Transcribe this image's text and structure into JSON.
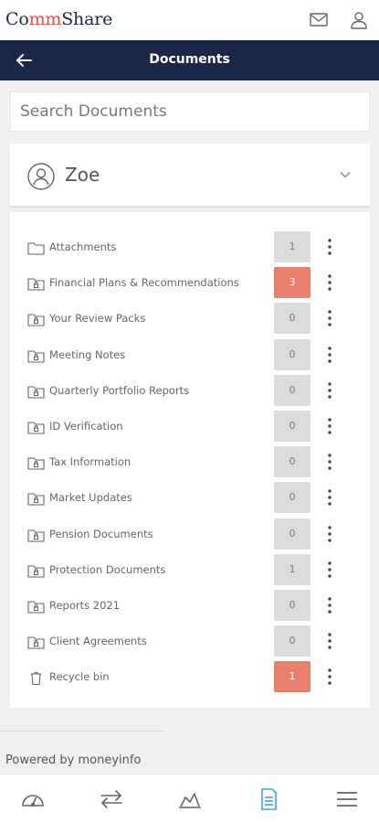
{
  "app": {
    "logo_prefix": "Co",
    "logo_mm": "mm",
    "logo_suffix": "Share"
  },
  "header": {
    "title": "Documents"
  },
  "search": {
    "placeholder": "Search Documents"
  },
  "client": {
    "name": "Zoe"
  },
  "folders": [
    {
      "label": "Attachments",
      "count": "1",
      "icon": "folder-icon",
      "highlight": false
    },
    {
      "label": "Financial Plans & Recommendations",
      "count": "3",
      "icon": "lock-folder-icon",
      "highlight": true
    },
    {
      "label": "Your Review Packs",
      "count": "0",
      "icon": "lock-folder-icon",
      "highlight": false
    },
    {
      "label": "Meeting Notes",
      "count": "0",
      "icon": "lock-folder-icon",
      "highlight": false
    },
    {
      "label": "Quarterly Portfolio Reports",
      "count": "0",
      "icon": "lock-folder-icon",
      "highlight": false
    },
    {
      "label": "ID Verification",
      "count": "0",
      "icon": "lock-folder-icon",
      "highlight": false
    },
    {
      "label": "Tax Information",
      "count": "0",
      "icon": "lock-folder-icon",
      "highlight": false
    },
    {
      "label": "Market Updates",
      "count": "0",
      "icon": "lock-folder-icon",
      "highlight": false
    },
    {
      "label": "Pension Documents",
      "count": "0",
      "icon": "lock-folder-icon",
      "highlight": false
    },
    {
      "label": "Protection Documents",
      "count": "1",
      "icon": "lock-folder-icon",
      "highlight": false
    },
    {
      "label": "Reports 2021",
      "count": "0",
      "icon": "lock-folder-icon",
      "highlight": false
    },
    {
      "label": "Client Agreements",
      "count": "0",
      "icon": "lock-folder-icon",
      "highlight": false
    },
    {
      "label": "Recycle bin",
      "count": "1",
      "icon": "trash-icon",
      "highlight": true
    }
  ],
  "footer": {
    "powered_by": "Powered by moneyinfo"
  },
  "nav": {
    "active": "documents",
    "active_color": "#3ea6d6",
    "items": [
      "dashboard-icon",
      "transfer-icon",
      "chart-icon",
      "document-icon",
      "menu-icon"
    ]
  },
  "colors": {
    "brand_navy": "#1b2747",
    "highlight_badge": "#e9806e",
    "neutral_badge": "#dcdcdc"
  }
}
